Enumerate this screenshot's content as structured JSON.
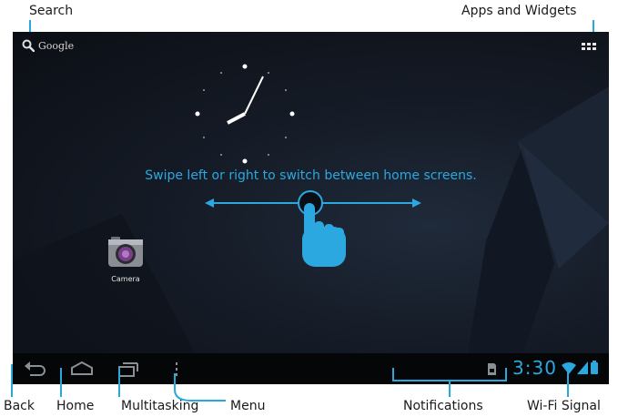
{
  "callouts": {
    "search": "Search",
    "apps_widgets": "Apps and Widgets",
    "back": "Back",
    "home": "Home",
    "multitasking": "Multitasking",
    "menu": "Menu",
    "notifications": "Notifications",
    "wifi_signal": "Wi-Fi Signal"
  },
  "home_screen": {
    "search_widget_label": "Google",
    "hint_text": "Swipe left or right to switch between home screens.",
    "apps": [
      {
        "label": "Camera",
        "icon": "camera-icon"
      }
    ]
  },
  "status_bar": {
    "time": "3:30",
    "notification_icon": "sd-card-icon",
    "wifi_icon": "wifi-icon",
    "signal_icon": "signal-icon",
    "battery_icon": "battery-icon"
  },
  "navigation": {
    "back_icon": "back-icon",
    "home_icon": "home-icon",
    "recents_icon": "recent-apps-icon",
    "menu_icon": "menu-dots-icon"
  },
  "colors": {
    "accent": "#2ba8e0",
    "background": "#0b0e14",
    "navbar": "#050608"
  }
}
